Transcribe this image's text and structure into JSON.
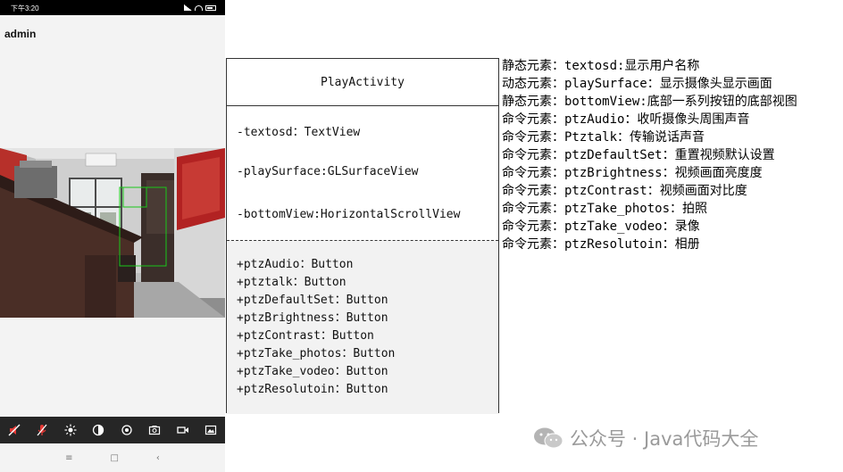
{
  "phone": {
    "status_time": "下午3:20",
    "username": "admin",
    "controls": [
      {
        "icon": "mute-speaker-icon",
        "name": "ptzAudio"
      },
      {
        "icon": "mute-mic-icon",
        "name": "Ptztalk"
      },
      {
        "icon": "brightness-icon",
        "name": "ptzBrightness"
      },
      {
        "icon": "contrast-icon",
        "name": "ptzContrast"
      },
      {
        "icon": "reset-icon",
        "name": "ptzDefaultSet"
      },
      {
        "icon": "camera-icon",
        "name": "ptzTake_photos"
      },
      {
        "icon": "video-icon",
        "name": "ptzTake_vodeo"
      },
      {
        "icon": "gallery-icon",
        "name": "ptzResolutoin"
      }
    ],
    "nav": [
      "≡",
      "□",
      "‹"
    ],
    "colors": {
      "muted_red": "#e53935",
      "bar_bg": "#262626"
    }
  },
  "classbox": {
    "name": "PlayActivity",
    "attributes": [
      "-textosd：TextView",
      "-playSurface:GLSurfaceView",
      "-bottomView:HorizontalScrollView"
    ],
    "methods": [
      "+ptzAudio：Button",
      "+ptztalk：Button",
      "+ptzDefaultSet：Button",
      "+ptzBrightness：Button",
      "+ptzContrast：Button",
      "+ptzTake_photos：Button",
      "+ptzTake_vodeo：Button",
      "+ptzResolutoin：Button"
    ]
  },
  "notes": [
    "静态元素：textosd:显示用户名称",
    "动态元素：playSurface：显示摄像头显示画面",
    "静态元素：bottomView:底部一系列按钮的底部视图",
    "命令元素：ptzAudio：收听摄像头周围声音",
    "命令元素：Ptztalk：传输说话声音",
    "命令元素：ptzDefaultSet：重置视频默认设置",
    "命令元素：ptzBrightness：视频画面亮度度",
    "命令元素：ptzContrast：视频画面对比度",
    "命令元素：ptzTake_photos：拍照",
    "命令元素：ptzTake_vodeo：录像",
    "命令元素：ptzResolutoin：相册"
  ],
  "watermark": "公众号 · Java代码大全"
}
